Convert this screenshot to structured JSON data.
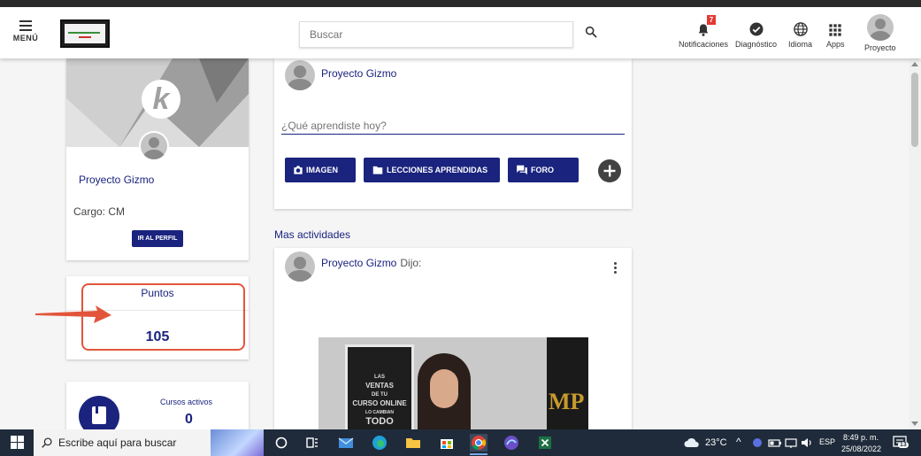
{
  "header": {
    "menu_label": "MENÚ",
    "search_placeholder": "Buscar",
    "items": [
      {
        "label": "Notificaciones",
        "icon": "bell-icon",
        "badge": "7"
      },
      {
        "label": "Diagnóstico",
        "icon": "check-circle-icon"
      },
      {
        "label": "Idioma",
        "icon": "globe-icon"
      },
      {
        "label": "Apps",
        "icon": "apps-grid-icon"
      },
      {
        "label": "Proyecto",
        "icon": "user-avatar"
      }
    ]
  },
  "profile": {
    "name": "Proyecto Gizmo",
    "role": "Cargo: CM",
    "profile_button": "IR AL PERFIL",
    "cover_letter": "k"
  },
  "points": {
    "label": "Puntos",
    "value": "105"
  },
  "courses": {
    "label": "Cursos activos",
    "value": "0"
  },
  "composer": {
    "author": "Proyecto Gizmo",
    "placeholder": "¿Qué aprendiste hoy?",
    "buttons": {
      "image": "IMAGEN",
      "lessons": "LECCIONES APRENDIDAS",
      "forum": "FORO"
    }
  },
  "feed": {
    "section_title": "Mas actividades",
    "post": {
      "author": "Proyecto Gizmo",
      "verb": "Dijo:",
      "video": {
        "sign_lines": [
          "LAS",
          "VENTAS",
          "DE TU",
          "CURSO ONLINE",
          "LO CAMBIAN",
          "TODO"
        ],
        "brand": "MP"
      }
    }
  },
  "taskbar": {
    "search_placeholder": "Escribe aquí para buscar",
    "weather": "23°C",
    "language": "ESP",
    "time": "8:49 p. m.",
    "date": "25/08/2022",
    "notifications": "13"
  },
  "colors": {
    "primary": "#1a237e",
    "highlight": "#e2553b",
    "badge": "#e53935"
  }
}
